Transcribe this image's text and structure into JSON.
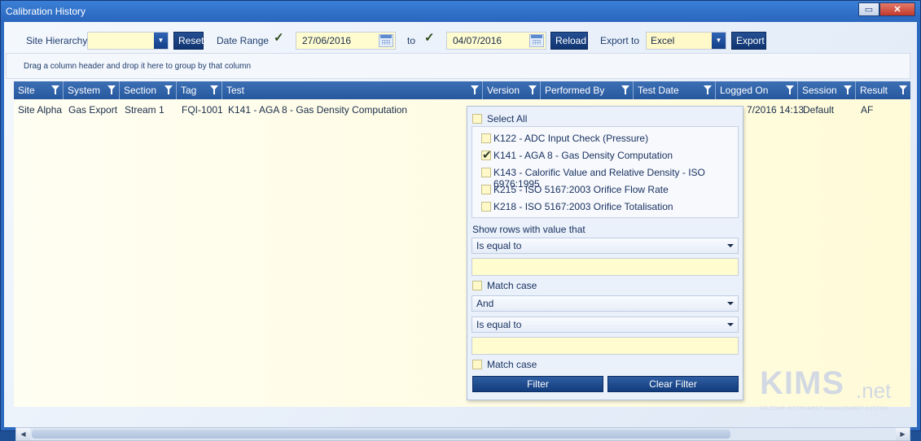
{
  "window": {
    "title": "Calibration History"
  },
  "toolbar": {
    "site_hierarchy_label": "Site Hierarchy",
    "site_hierarchy_value": "",
    "reset_label": "Reset",
    "date_range_label": "Date Range",
    "date_from": "27/06/2016",
    "to_label": "to",
    "date_to": "04/07/2016",
    "reload_label": "Reload",
    "export_to_label": "Export to",
    "export_format": "Excel",
    "export_label": "Export"
  },
  "group_panel": {
    "hint": "Drag a column header and drop it here to group by that column"
  },
  "grid": {
    "columns": [
      "Site",
      "System",
      "Section",
      "Tag",
      "Test",
      "Version",
      "Performed By",
      "Test Date",
      "Logged On",
      "Session",
      "Result"
    ],
    "rows": [
      {
        "site": "Site Alpha",
        "system": "Gas Export",
        "section": "Stream 1",
        "tag": "FQI-1001",
        "test": "K141 - AGA 8 - Gas Density Computation",
        "logged_on": "7/2016 14:13",
        "session": "Default",
        "result": "AF"
      }
    ]
  },
  "filter_popup": {
    "select_all": "Select All",
    "items": [
      {
        "label": "K122 - ADC Input Check (Pressure)",
        "checked": false
      },
      {
        "label": "K141 - AGA 8 - Gas Density Computation",
        "checked": true
      },
      {
        "label": "K143 - Calorific Value and Relative Density - ISO 6976:1995",
        "checked": false
      },
      {
        "label": "K215 - ISO 5167:2003 Orifice Flow Rate",
        "checked": false
      },
      {
        "label": "K218 - ISO 5167:2003 Orifice Totalisation",
        "checked": false
      }
    ],
    "show_rows_label": "Show rows with value that",
    "operator1": "Is equal to",
    "value1": "",
    "match_case1": "Match case",
    "logic": "And",
    "operator2": "Is equal to",
    "value2": "",
    "match_case2": "Match case",
    "filter_label": "Filter",
    "clear_filter_label": "Clear Filter"
  },
  "watermark": {
    "brand": "KIMS",
    "suffix": ".net",
    "tagline": "KELTON® INSTRUMENT MANAGEMENT SYSTEM"
  }
}
